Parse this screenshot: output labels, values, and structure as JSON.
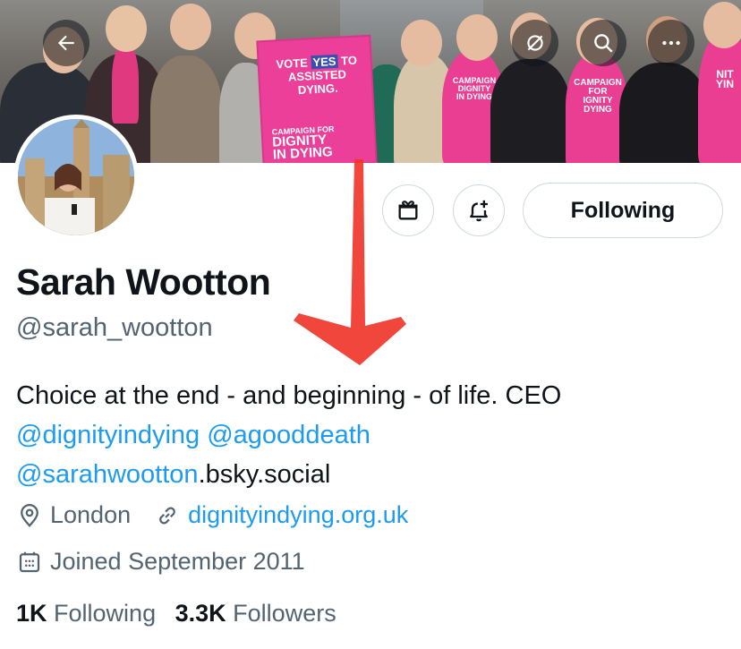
{
  "banner": {
    "sign": {
      "line1_pre": "VOTE ",
      "line1_yes": "YES",
      "line1_post": " TO",
      "line2": "ASSISTED",
      "line3": "DYING.",
      "campaign_small": "CAMPAIGN FOR",
      "campaign_big_1": "DIGNITY",
      "campaign_big_2": "IN DYING"
    },
    "hoodie_1": "CAMPAIGN FOR\nDIGNITY\nIN DYING",
    "hoodie_2": "CAMPAIGN FOR\nDIGNITY\nDYING",
    "hoodie_3": "NIT\nYIN"
  },
  "buttons": {
    "following_label": "Following"
  },
  "profile": {
    "name": "Sarah Wootton",
    "handle": "@sarah_wootton",
    "bio": {
      "line1": "Choice at the end - and beginning - of life. CEO",
      "mention1": "@dignityindying",
      "mention2": "@agooddeath",
      "mention3": "@sarahwootton",
      "suffix3": ".bsky.social"
    },
    "location": "London",
    "website": "dignityindying.org.uk",
    "joined": "Joined September 2011"
  },
  "stats": {
    "following_count": "1K",
    "following_label": "Following",
    "followers_count": "3.3K",
    "followers_label": "Followers"
  },
  "colors": {
    "accent": "#1d9bf0",
    "secondary_text": "#536471",
    "annotation_arrow": "#f0362b",
    "campaign_pink": "#ec3f9a"
  },
  "icons": [
    "back-arrow-icon",
    "translate-off-icon",
    "search-icon",
    "more-icon",
    "gift-icon",
    "notification-add-icon",
    "location-icon",
    "link-icon",
    "calendar-icon"
  ]
}
